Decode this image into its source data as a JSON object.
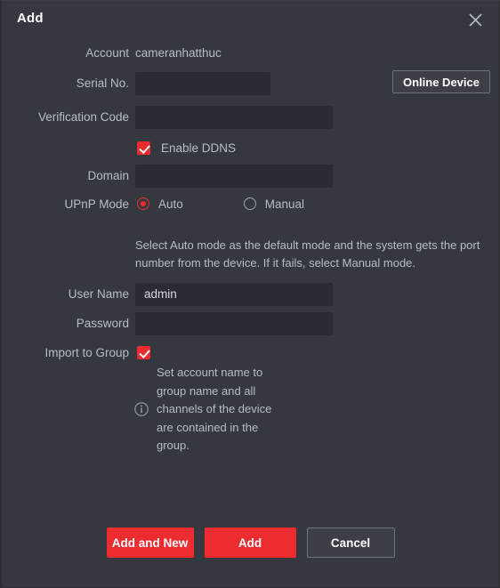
{
  "dialog": {
    "title": "Add",
    "close_icon": "close-icon"
  },
  "form": {
    "account": {
      "label": "Account",
      "value": "cameranhatthuc"
    },
    "serial_no": {
      "label": "Serial No.",
      "value": "",
      "placeholder": ""
    },
    "online_device_button": "Online Device",
    "verification_code": {
      "label": "Verification Code",
      "value": "",
      "placeholder": ""
    },
    "enable_ddns": {
      "label": "Enable DDNS",
      "checked": true
    },
    "domain": {
      "label": "Domain",
      "value": "",
      "placeholder": ""
    },
    "upnp_mode": {
      "label": "UPnP Mode",
      "options": [
        {
          "label": "Auto",
          "selected": true
        },
        {
          "label": "Manual",
          "selected": false
        }
      ]
    },
    "upnp_hint": "Select Auto mode as the default mode and the system gets the port number from the device. If it fails, select Manual mode.",
    "user_name": {
      "label": "User Name",
      "value": "admin",
      "placeholder": ""
    },
    "password": {
      "label": "Password",
      "value": "",
      "placeholder": ""
    },
    "import_to_group": {
      "label": "Import to Group",
      "checked": true
    },
    "import_hint": {
      "icon": "info-icon",
      "text": "Set account name to group name and all channels of the device are contained in the group."
    }
  },
  "footer": {
    "add_and_new": "Add and New",
    "add": "Add",
    "cancel": "Cancel"
  },
  "colors": {
    "accent_red": "#ee2b2f",
    "background": "#35383e",
    "field_background": "#292c32",
    "text": "#b7bcc6",
    "title_text": "#ffffff"
  }
}
